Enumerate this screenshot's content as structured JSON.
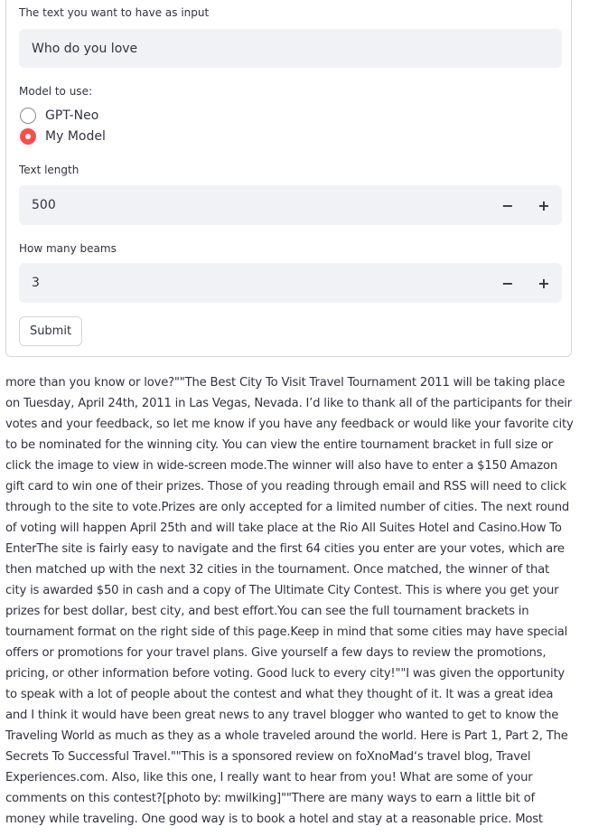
{
  "form": {
    "input_label": "The text you want to have as input",
    "input_value": "Who do you love",
    "model_label": "Model to use:",
    "model_options": [
      {
        "label": "GPT-Neo",
        "selected": false
      },
      {
        "label": "My Model",
        "selected": true
      }
    ],
    "length_label": "Text length",
    "length_value": "500",
    "beams_label": "How many beams",
    "beams_value": "3",
    "minus_glyph": "−",
    "plus_glyph": "+",
    "submit_label": "Submit"
  },
  "output": {
    "text": "more than you know or love?\"\"The Best City To Visit Travel Tournament 2011 will be taking place on Tuesday, April 24th, 2011 in Las Vegas, Nevada. I’d like to thank all of the participants for their votes and your feedback, so let me know if you have any feedback or would like your favorite city to be nominated for the winning city. You can view the entire tournament bracket in full size or click the image to view in wide-screen mode.The winner will also have to enter a $150 Amazon gift card to win one of their prizes. Those of you reading through email and RSS will need to click through to the site to vote.Prizes are only accepted for a limited number of cities. The next round of voting will happen April 25th and will take place at the Rio All Suites Hotel and Casino.How To EnterThe site is fairly easy to navigate and the first 64 cities you enter are your votes, which are then matched up with the next 32 cities in the tournament. Once matched, the winner of that city is awarded $50 in cash and a copy of The Ultimate City Contest. This is where you get your prizes for best dollar, best city, and best effort.You can see the full tournament brackets in tournament format on the right side of this page.Keep in mind that some cities may have special offers or promotions for your travel plans. Give yourself a few days to review the promotions, pricing, or other information before voting. Good luck to every city!\"\"I was given the opportunity to speak with a lot of people about the contest and what they thought of it. It was a great idea and I think it would have been great news to any travel blogger who wanted to get to know the Traveling World as much as they as a whole traveled around the world. Here is Part 1, Part 2, The Secrets To Successful Travel.\"\"This is a sponsored review on foXnoMad‘s travel blog, Travel Experiences.com. Also, like this one, I really want to hear from you! What are some of your comments on this contest?[photo by: mwilking]\"\"There are many ways to earn a little bit of money while traveling. One good way is to book a hotel and stay at a reasonable price. Most"
  },
  "colors": {
    "accent": "#ff4b4b",
    "input_bg": "#f0f2f6",
    "text": "#31333f",
    "border": "#d6d6d9"
  }
}
